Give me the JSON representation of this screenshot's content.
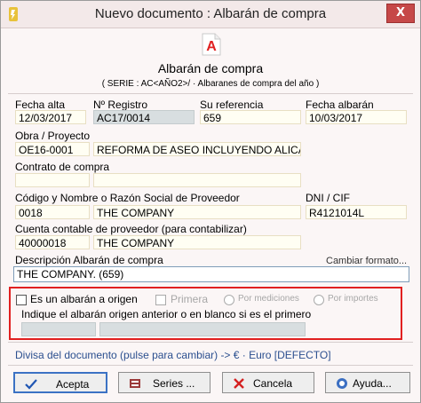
{
  "window": {
    "title": "Nuevo documento : Albarán de compra",
    "close_label": "X"
  },
  "header": {
    "icon_letter": "A",
    "title": "Albarán de compra",
    "subtitle": "( SERIE : AC<AÑO2>/ · Albaranes de compra del año )"
  },
  "fields": {
    "fecha_alta": {
      "label": "Fecha alta",
      "value": "12/03/2017"
    },
    "num_registro": {
      "label": "Nº Registro",
      "value": "AC17/0014"
    },
    "su_referencia": {
      "label": "Su referencia",
      "value": "659"
    },
    "fecha_albaran": {
      "label": "Fecha albarán",
      "value": "10/03/2017"
    },
    "obra": {
      "label": "Obra / Proyecto",
      "code": "OE16-0001",
      "name": "REFORMA DE ASEO INCLUYENDO ALICA"
    },
    "contrato": {
      "label": "Contrato de compra",
      "code": "",
      "name": ""
    },
    "proveedor": {
      "label": "Código y Nombre o Razón Social de Proveedor",
      "code": "0018",
      "name": "THE COMPANY"
    },
    "dni": {
      "label": "DNI / CIF",
      "value": "R4121014L"
    },
    "cuenta": {
      "label": "Cuenta contable de proveedor (para contabilizar)",
      "code": "40000018",
      "name": "THE COMPANY"
    },
    "descripcion": {
      "label": "Descripción Albarán de compra",
      "value": "THE COMPANY. (659)",
      "link": "Cambiar formato..."
    }
  },
  "origin": {
    "checkbox_label": "Es un albarán a origen",
    "primera_label": "Primera",
    "por_mediciones": "Por mediciones",
    "por_importes": "Por importes",
    "hint": "Indique el albarán origen anterior o en blanco si es el primero"
  },
  "currency": {
    "text": "Divisa del documento (pulse para cambiar) -> € · Euro [DEFECTO]"
  },
  "buttons": {
    "accept": "Acepta",
    "series": "Series ...",
    "cancel": "Cancela",
    "help": "Ayuda..."
  },
  "colors": {
    "accent": "#e12020",
    "title_bar": "#f3e9e9",
    "field_bg": "#fffef3"
  }
}
